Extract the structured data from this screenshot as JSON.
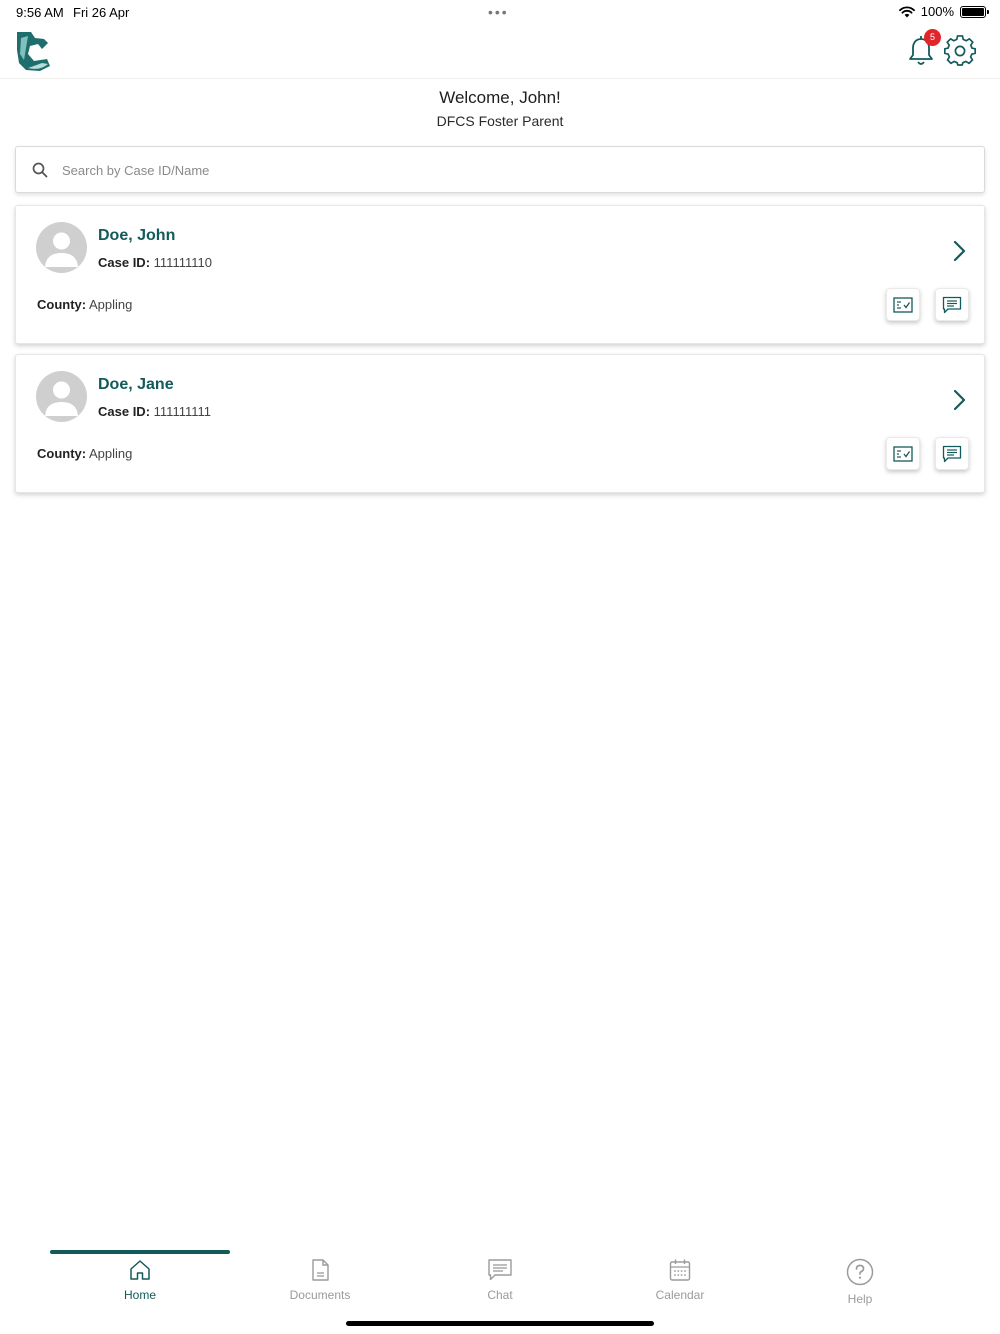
{
  "status_bar": {
    "time": "9:56 AM",
    "date": "Fri 26 Apr",
    "battery": "100%"
  },
  "header": {
    "notification_count": "5"
  },
  "welcome": {
    "greeting": "Welcome, John!",
    "role": "DFCS Foster Parent"
  },
  "search": {
    "placeholder": "Search by Case ID/Name",
    "value": ""
  },
  "cases": [
    {
      "name": "Doe, John",
      "case_id_label": "Case ID:",
      "case_id": "111111110",
      "county_label": "County:",
      "county": "Appling"
    },
    {
      "name": "Doe, Jane",
      "case_id_label": "Case ID:",
      "case_id": "111111111",
      "county_label": "County:",
      "county": "Appling"
    }
  ],
  "tabs": [
    {
      "label": "Home",
      "icon": "home-icon",
      "active": true
    },
    {
      "label": "Documents",
      "icon": "document-icon",
      "active": false
    },
    {
      "label": "Chat",
      "icon": "chat-icon",
      "active": false
    },
    {
      "label": "Calendar",
      "icon": "calendar-icon",
      "active": false
    },
    {
      "label": "Help",
      "icon": "help-icon",
      "active": false
    }
  ],
  "colors": {
    "brand": "#135b5b",
    "badge": "#e0262b",
    "inactive": "#9b9b9b"
  }
}
